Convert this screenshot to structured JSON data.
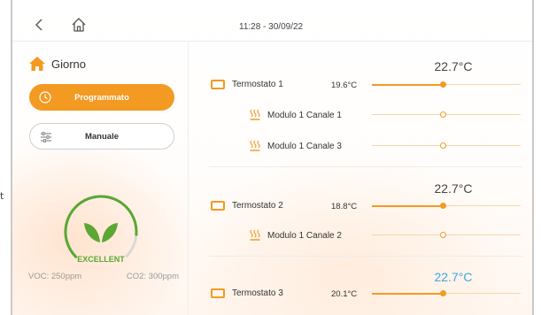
{
  "edge_text": "t",
  "header": {
    "datetime": "11:28 - 30/09/22"
  },
  "zone": {
    "title": "Giorno",
    "modes": [
      {
        "label": "Programmato",
        "active": true,
        "icon": "clock-icon"
      },
      {
        "label": "Manuale",
        "active": false,
        "icon": "sliders-icon"
      }
    ]
  },
  "air_quality": {
    "status": "EXCELLENT",
    "voc": "VOC: 250ppm",
    "co2": "CO2: 300ppm",
    "level": 0.85
  },
  "thermostats": [
    {
      "name": "Termostato 1",
      "temp": "19.6°C",
      "setpoint": "22.7°C",
      "setpoint_color": "#444444",
      "slider_position": 0.48,
      "modules": [
        {
          "name": "Modulo 1 Canale 1",
          "slider_position": 0.48
        },
        {
          "name": "Modulo 1 Canale 3",
          "slider_position": 0.48
        }
      ]
    },
    {
      "name": "Termostato 2",
      "temp": "18.8°C",
      "setpoint": "22.7°C",
      "setpoint_color": "#444444",
      "slider_position": 0.48,
      "modules": [
        {
          "name": "Modulo 1 Canale 2",
          "slider_position": 0.48
        }
      ]
    },
    {
      "name": "Termostato 3",
      "temp": "20.1°C",
      "setpoint": "22.7°C",
      "setpoint_color": "#3aa7e0",
      "slider_position": 0.48,
      "modules": []
    }
  ],
  "colors": {
    "accent": "#f39a22",
    "gauge_green": "#5aa733",
    "gauge_track": "#d9d9d9",
    "blue_setpoint": "#3aa7e0"
  }
}
